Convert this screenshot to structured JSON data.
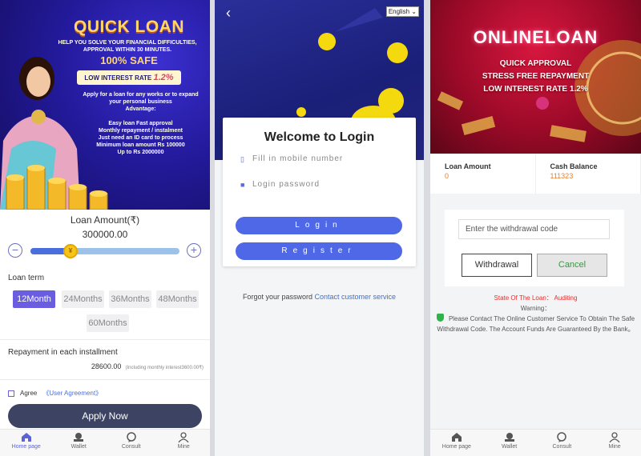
{
  "panel1": {
    "banner": {
      "title": "QUICK LOAN",
      "subtitle_1": "HELP YOU SOLVE YOUR FINANCIAL DIFFICULTIES,",
      "subtitle_2": "APPROVAL WITHIN 30 MINUTES.",
      "safe": "100% SAFE",
      "rate_label": "LOW INTEREST RATE",
      "rate_value": "1.2%",
      "body": [
        "Apply for a loan for any works or to expand",
        "your personal business",
        "Advantage:",
        "",
        "Easy loan Fast approval",
        "Monthly repayment / instalment",
        "Just need an ID card to process",
        "Minimum loan amount Rs 100000",
        "Up to Rs 2000000"
      ]
    },
    "amount_label": "Loan Amount(₹)",
    "amount_value": "300000.00",
    "minus": "−",
    "plus": "+",
    "slider_thumb": "¥",
    "slider_fraction": 0.28,
    "loan_term_label": "Loan term",
    "terms": [
      "12Month",
      "24Months",
      "36Months",
      "48Months",
      "60Months"
    ],
    "repayment_label": "Repayment in each installment",
    "repayment_value": "28600.00",
    "repayment_note": "(Including monthly interest3600.00₹)",
    "agree_label": "Agree",
    "agreement_link": "《User Agreement》",
    "apply_button": "Apply Now",
    "tabs": [
      "Home page",
      "Wallet",
      "Consult",
      "Mine"
    ]
  },
  "panel2": {
    "back_icon": "‹",
    "language": "English",
    "title": "Welcome to Login",
    "mobile_placeholder": "Fill in mobile number",
    "password_placeholder": "Login password",
    "login_button": "Login",
    "register_button": "Register",
    "forgot_text": "Forgot your password",
    "contact_link": "Contact customer service"
  },
  "panel3": {
    "banner": {
      "title": "ONLINELOAN",
      "line1": "QUICK APPROVAL",
      "line2": "STRESS FREE REPAYMENT",
      "line3": "LOW INTEREST RATE 1.2%"
    },
    "loan_amount_label": "Loan Amount",
    "loan_amount_value": "0",
    "cash_balance_label": "Cash Balance",
    "cash_balance_value": "111323",
    "withdrawal_placeholder": "Enter the withdrawal code",
    "withdrawal_button": "Withdrawal",
    "cancel_button": "Cancel",
    "state_text": "State Of The Loan：  Auditing",
    "warning_heading": "Warning：",
    "warning_text": "Please Contact The Online Customer Service To Obtain The Safe Withdrawal Code. The Account Funds Are Guaranteed By the Bank。",
    "tabs": [
      "Home page",
      "Wallet",
      "Consult",
      "Mine"
    ]
  },
  "colors": {
    "accent": "#6a5de0",
    "button_blue": "#4e68e8",
    "apply_dark": "#3d4463",
    "orange_value": "#f07b22",
    "status_red": "#e23030"
  }
}
